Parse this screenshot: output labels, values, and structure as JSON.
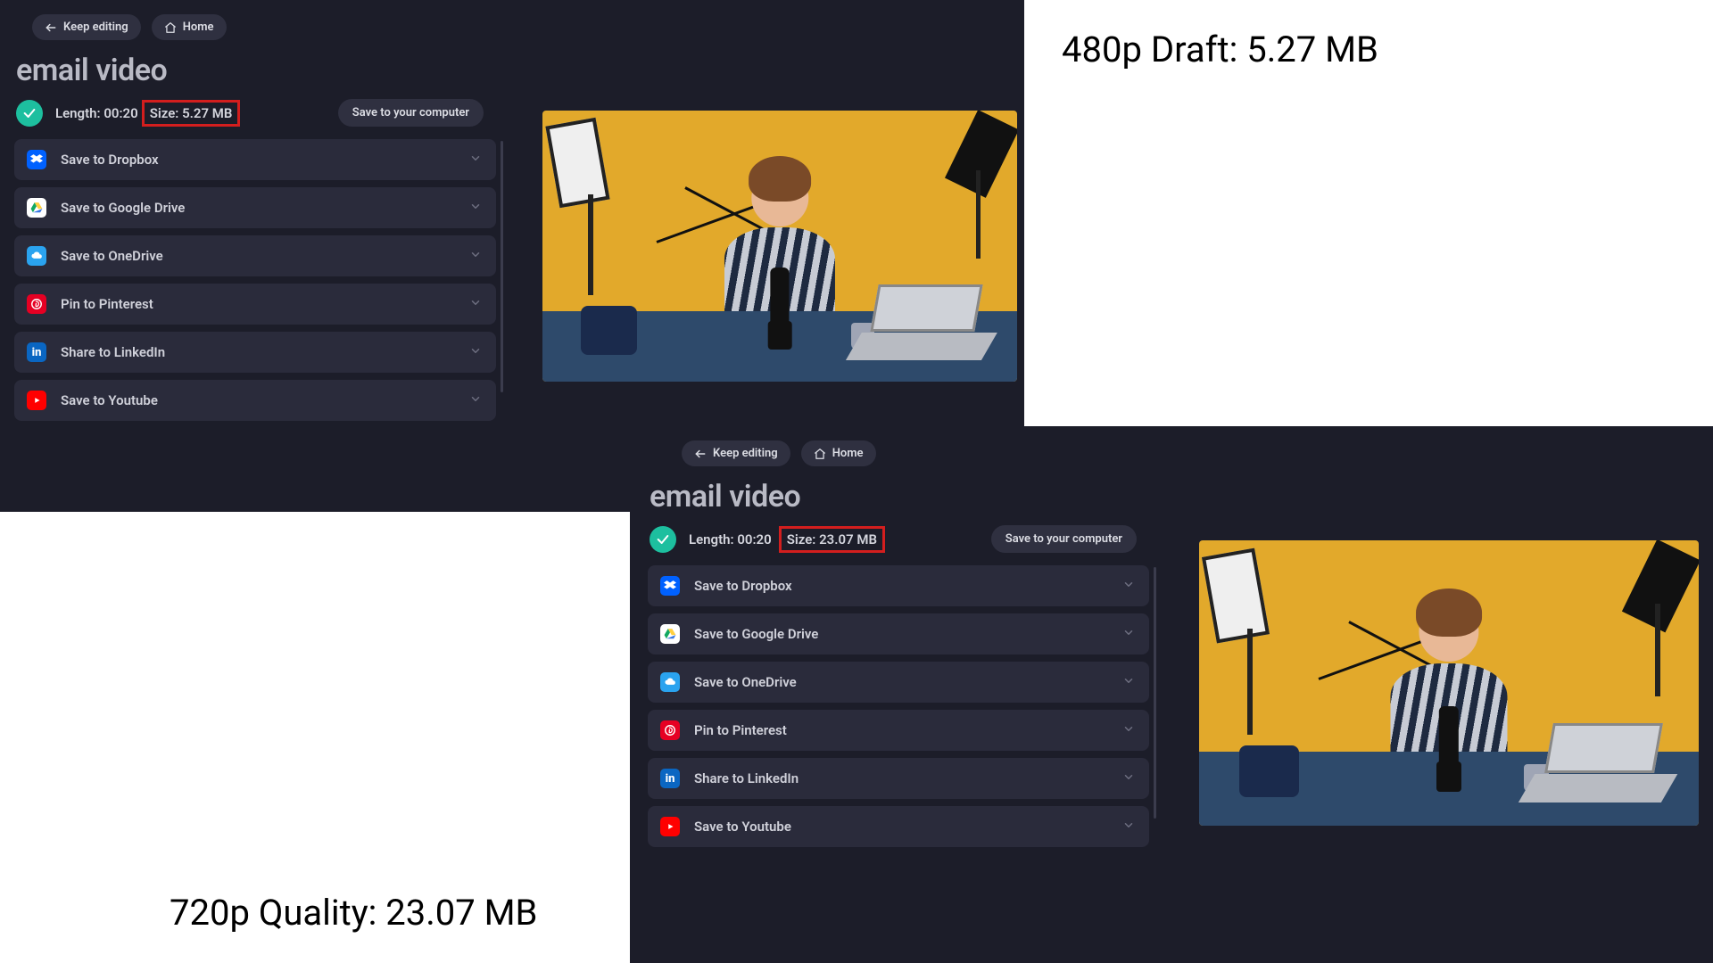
{
  "annotations": {
    "top_right": "480p Draft: 5.27 MB",
    "bottom_left": "720p Quality: 23.07 MB"
  },
  "panel1": {
    "keep_editing": "Keep editing",
    "home": "Home",
    "title": "email video",
    "length_label": "Length: 00:20",
    "size_label": "Size: 5.27 MB",
    "save_local": "Save to your computer",
    "options": [
      {
        "key": "dropbox",
        "label": "Save to Dropbox"
      },
      {
        "key": "gdrive",
        "label": "Save to Google Drive"
      },
      {
        "key": "onedrive",
        "label": "Save to OneDrive"
      },
      {
        "key": "pinterest",
        "label": "Pin to Pinterest"
      },
      {
        "key": "linkedin",
        "label": "Share to LinkedIn"
      },
      {
        "key": "youtube",
        "label": "Save to Youtube"
      }
    ]
  },
  "panel2": {
    "keep_editing": "Keep editing",
    "home": "Home",
    "title": "email video",
    "length_label": "Length: 00:20",
    "size_label": "Size: 23.07 MB",
    "save_local": "Save to your computer",
    "options": [
      {
        "key": "dropbox",
        "label": "Save to Dropbox"
      },
      {
        "key": "gdrive",
        "label": "Save to Google Drive"
      },
      {
        "key": "onedrive",
        "label": "Save to OneDrive"
      },
      {
        "key": "pinterest",
        "label": "Pin to Pinterest"
      },
      {
        "key": "linkedin",
        "label": "Share to LinkedIn"
      },
      {
        "key": "youtube",
        "label": "Save to Youtube"
      }
    ]
  }
}
